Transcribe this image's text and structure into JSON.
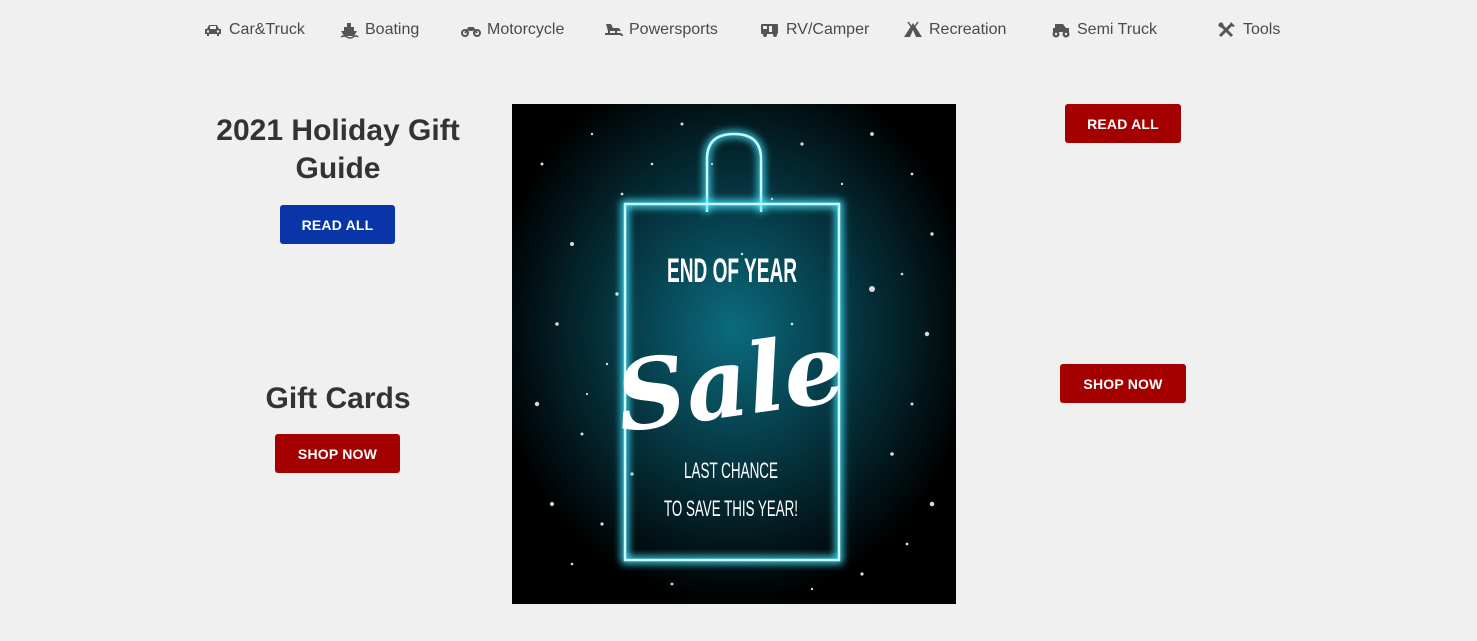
{
  "nav": {
    "items": [
      {
        "label": "Car&Truck",
        "icon": "car-icon"
      },
      {
        "label": "Boating",
        "icon": "boat-icon"
      },
      {
        "label": "Motorcycle",
        "icon": "motorcycle-icon"
      },
      {
        "label": "Powersports",
        "icon": "snowmobile-icon"
      },
      {
        "label": "RV/Camper",
        "icon": "rv-icon"
      },
      {
        "label": "Recreation",
        "icon": "tent-icon"
      },
      {
        "label": "Semi Truck",
        "icon": "monster-truck-icon"
      },
      {
        "label": "Tools",
        "icon": "tools-icon"
      }
    ]
  },
  "left": {
    "gift_guide_title_line1": "2021 Holiday Gift",
    "gift_guide_title_line2": "Guide",
    "gift_guide_button": "READ ALL",
    "gift_cards_title": "Gift Cards",
    "gift_cards_button": "SHOP NOW"
  },
  "promo": {
    "line1": "END OF YEAR",
    "line2": "Sale",
    "line3": "LAST CHANCE",
    "line4": "TO SAVE THIS YEAR!"
  },
  "right": {
    "read_button": "READ ALL",
    "shop_button": "SHOP NOW"
  },
  "colors": {
    "page_bg": "#f0f0f0",
    "button_blue": "#0a35a8",
    "button_red": "#a40000",
    "neon": "#3fe3ff"
  }
}
